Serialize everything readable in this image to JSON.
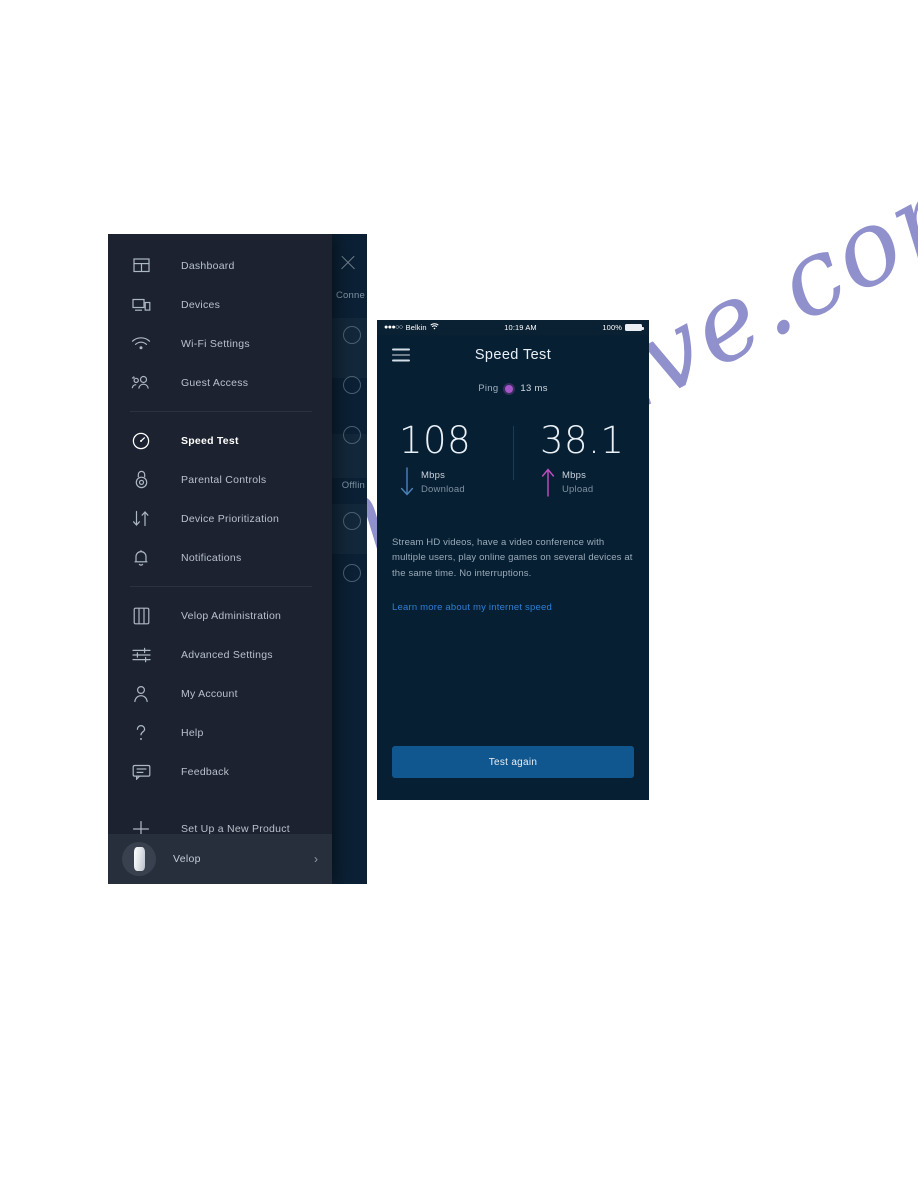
{
  "watermark": {
    "text": "manualslive.com"
  },
  "sidebar": {
    "groups": [
      {
        "items": [
          {
            "label": "Dashboard",
            "icon": "dashboard-icon",
            "active": false
          },
          {
            "label": "Devices",
            "icon": "devices-icon",
            "active": false
          },
          {
            "label": "Wi-Fi Settings",
            "icon": "wifi-icon",
            "active": false
          },
          {
            "label": "Guest Access",
            "icon": "guest-access-icon",
            "active": false
          }
        ]
      },
      {
        "items": [
          {
            "label": "Speed Test",
            "icon": "speedometer-icon",
            "active": true
          },
          {
            "label": "Parental Controls",
            "icon": "lock-icon",
            "active": false
          },
          {
            "label": "Device Prioritization",
            "icon": "arrows-updown-icon",
            "active": false
          },
          {
            "label": "Notifications",
            "icon": "bell-icon",
            "active": false
          }
        ]
      },
      {
        "items": [
          {
            "label": "Velop Administration",
            "icon": "velop-node-icon",
            "active": false
          },
          {
            "label": "Advanced Settings",
            "icon": "sliders-icon",
            "active": false
          },
          {
            "label": "My Account",
            "icon": "person-icon",
            "active": false
          },
          {
            "label": "Help",
            "icon": "question-icon",
            "active": false
          },
          {
            "label": "Feedback",
            "icon": "comment-icon",
            "active": false
          }
        ]
      },
      {
        "items": [
          {
            "label": "Set Up a New Product",
            "icon": "plus-icon",
            "active": false
          }
        ]
      }
    ],
    "footer": {
      "label": "Velop",
      "chevron": "›"
    }
  },
  "background_screen": {
    "close_icon": "close-icon",
    "connected_label": "Conne",
    "offline_label": "Offlin"
  },
  "phone": {
    "statusbar": {
      "signal_dots": "●●●○○",
      "carrier": "Belkin",
      "wifi_icon": "wifi-icon",
      "time": "10:19 AM",
      "battery_pct": "100%"
    },
    "header": {
      "menu_icon": "hamburger-menu-icon",
      "title": "Speed Test"
    },
    "ping": {
      "label": "Ping",
      "value": "13 ms",
      "dot_color": "#a855c9"
    },
    "download": {
      "value": "108",
      "unit": "Mbps",
      "direction": "Download",
      "arrow_icon": "arrow-down-icon",
      "arrow_color": "#4b82bd"
    },
    "upload": {
      "value": "38.1",
      "unit": "Mbps",
      "direction": "Upload",
      "arrow_icon": "arrow-up-icon",
      "arrow_color": "#c14fc1"
    },
    "description": "Stream HD videos, have a video conference with multiple users, play online games on several devices at the same time. No interruptions.",
    "learn_more": "Learn more about my internet speed",
    "test_button": "Test again"
  },
  "colors": {
    "drawer_bg": "#1c2230",
    "panel_bg": "#0b2034",
    "phone_bg": "#071f33",
    "accent_button": "#11578f",
    "link": "#2f7fd4"
  }
}
